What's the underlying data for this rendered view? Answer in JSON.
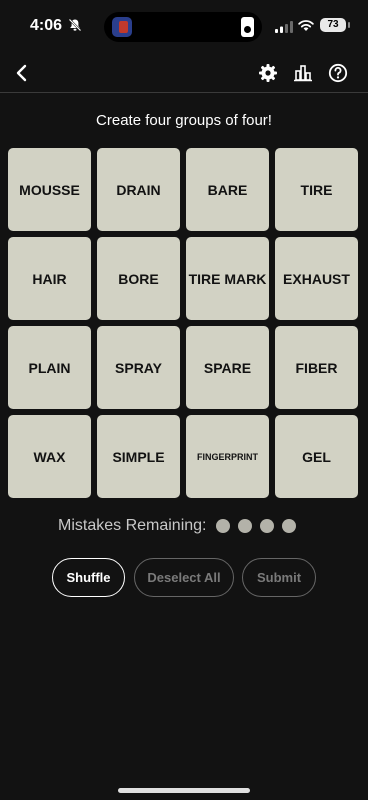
{
  "status_bar": {
    "time": "4:06",
    "battery": "73"
  },
  "header": {
    "back_icon": "chevron-left-icon",
    "settings_icon": "gear-icon",
    "stats_icon": "bar-chart-icon",
    "help_icon": "question-circle-icon"
  },
  "game": {
    "instructions": "Create four groups of four!",
    "tiles": [
      "MOUSSE",
      "DRAIN",
      "BARE",
      "TIRE",
      "HAIR",
      "BORE",
      "TIRE MARK",
      "EXHAUST",
      "PLAIN",
      "SPRAY",
      "SPARE",
      "FIBER",
      "WAX",
      "SIMPLE",
      "FINGERPRINT",
      "GEL"
    ],
    "mistakes_label": "Mistakes Remaining:",
    "mistakes_remaining": 4
  },
  "actions": {
    "shuffle": "Shuffle",
    "deselect": "Deselect All",
    "submit": "Submit"
  },
  "colors": {
    "background": "#121212",
    "tile": "#d2d2c4",
    "dot": "#b3b2a9"
  }
}
